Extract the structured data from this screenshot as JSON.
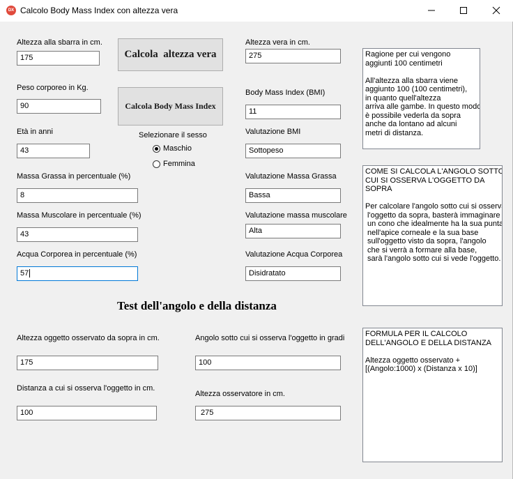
{
  "window": {
    "icon_text": "DX",
    "title": "Calcolo Body Mass Index con altezza vera",
    "minimize_glyph": "—",
    "close_glyph": "✕"
  },
  "left": {
    "altezza_sbarra": {
      "label": "Altezza alla sbarra in cm.",
      "value": "175"
    },
    "peso": {
      "label": "Peso corporeo in Kg.",
      "value": "90"
    },
    "eta": {
      "label": "Età in anni",
      "value": "43"
    },
    "massa_grassa": {
      "label": "Massa Grassa in percentuale      (%)",
      "value": "8"
    },
    "massa_muscolare": {
      "label": "Massa Muscolare in percentuale (%)",
      "value": "43"
    },
    "acqua": {
      "label": "Acqua Corporea in percentuale  (%)",
      "value": "57"
    }
  },
  "buttons": {
    "calcola_altezza": "Calcola  altezza vera",
    "calcola_bmi": "Calcola Body Mass Index"
  },
  "sex": {
    "label": "Selezionare il sesso",
    "options": [
      "Maschio",
      "Femmina"
    ],
    "selected": "Maschio"
  },
  "middle": {
    "altezza_vera": {
      "label": "Altezza vera in cm.",
      "value": "275"
    },
    "bmi": {
      "label": "Body Mass Index (BMI)",
      "value": "11"
    },
    "valutazione_bmi": {
      "label": "Valutazione BMI",
      "value": "Sottopeso"
    },
    "valutazione_grassa": {
      "label": "Valutazione Massa Grassa",
      "value": "Bassa"
    },
    "valutazione_muscolare": {
      "label": "Valutazione massa muscolare",
      "value": "Alta"
    },
    "valutazione_acqua": {
      "label": "Valutazione Acqua Corporea",
      "value": "Disidratato"
    }
  },
  "notes": {
    "note1": "Ragione per cui vengono\naggiunti 100 centimetri\n\nAll'altezza alla sbarra viene\naggiunto 100 (100 centimetri),\nin quanto quell'altezza\narriva alle gambe. In questo modo\nè possibile vederla da sopra\nanche da lontano ad alcuni\nmetri di distanza.",
    "note2": "COME SI CALCOLA L'ANGOLO SOTTO\nCUI SI OSSERVA L'OGGETTO DA\nSOPRA\n\nPer calcolare l'angolo sotto cui si osserva\n l'oggetto da sopra, basterà immaginare\n un cono che idealmente ha la sua punta\n nell'apice corneale e la sua base\n sull'oggetto visto da sopra, l'angolo\n che si verrà a formare alla base,\n sarà l'angolo sotto cui si vede l'oggetto.",
    "note3": "FORMULA PER IL CALCOLO\nDELL'ANGOLO E DELLA DISTANZA\n\nAltezza oggetto osservato +\n[(Angolo:1000) x (Distanza x 10)]"
  },
  "test": {
    "title": "Test dell'angolo e della distanza",
    "altezza_oggetto": {
      "label": "Altezza oggetto osservato da sopra in cm.",
      "value": "175"
    },
    "distanza": {
      "label": "Distanza a cui si osserva l'oggetto in cm.",
      "value": "100"
    },
    "angolo": {
      "label": "Angolo sotto cui si osserva l'oggetto in gradi",
      "value": "100"
    },
    "altezza_osservatore": {
      "label": "Altezza osservatore in cm.",
      "value": " 275"
    }
  }
}
